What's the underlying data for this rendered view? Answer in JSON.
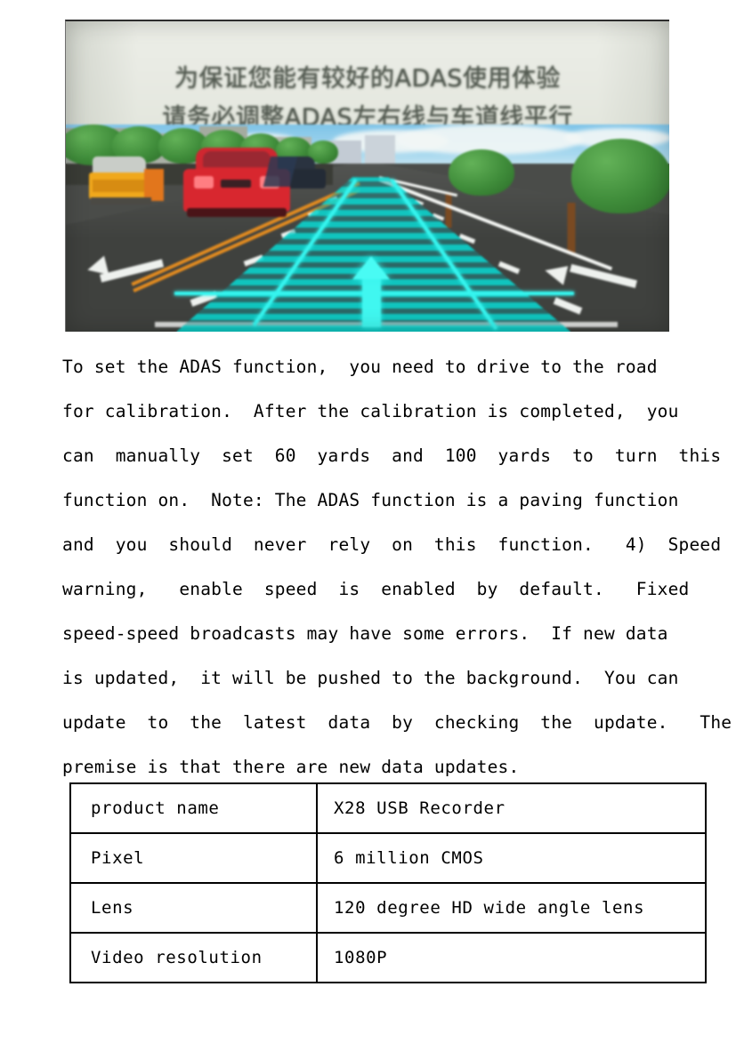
{
  "figure": {
    "name": "adas-calibration-illustration",
    "banner": {
      "line1": "为保证您能有较好的ADAS使用体验",
      "line2": "请务必调整ADAS左右线与车道线平行"
    },
    "scene": {
      "description": "road-view-with-adas-lane-overlay",
      "overlay_color": "#12d6d0",
      "overlay_edge_color": "#35f4ee",
      "road_color": "#3f413e",
      "grass_color": "#2b9430",
      "sky_color": "#8ecbe9",
      "yellow_divider_color": "#e08a20",
      "red_car_color": "#d8272f",
      "yellow_truck_color": "#f0a81c"
    }
  },
  "paragraph": {
    "full": "To set the ADAS function, you need to drive to the road for calibration. After the calibration is completed, you can manually set 60 yards and 100 yards to turn this function on. Note: The ADAS function is a paving function and you should never rely on this function. 4) Speed warning, enable speed is enabled by default. Fixed speed-speed broadcasts may have some errors. If new data is updated, it will be pushed to the background. You can update to the latest data by checking the update. The premise is that there are new data updates.",
    "lines": [
      "To set the ADAS function,  you need to drive to the road",
      "for calibration.  After the calibration is completed,  you",
      "can  manually  set  60  yards  and  100  yards  to  turn  this",
      "function on.  Note: The ADAS function is a paving function",
      "and  you  should  never  rely  on  this  function.   4)  Speed",
      "warning,   enable  speed  is  enabled  by  default.   Fixed",
      "speed-speed broadcasts may have some errors.  If new data",
      "is updated,  it will be pushed to the background.  You can",
      "update  to  the  latest  data  by  checking  the  update.   The",
      "premise is that there are new data updates."
    ]
  },
  "spec_table": {
    "name": "product-specification-table",
    "rows": [
      {
        "key": "product name",
        "value": "X28 USB Recorder"
      },
      {
        "key": "Pixel",
        "value": "6 million CMOS"
      },
      {
        "key": "Lens",
        "value": "120 degree HD wide angle lens"
      },
      {
        "key": "Video resolution",
        "value": "1080P"
      }
    ]
  }
}
